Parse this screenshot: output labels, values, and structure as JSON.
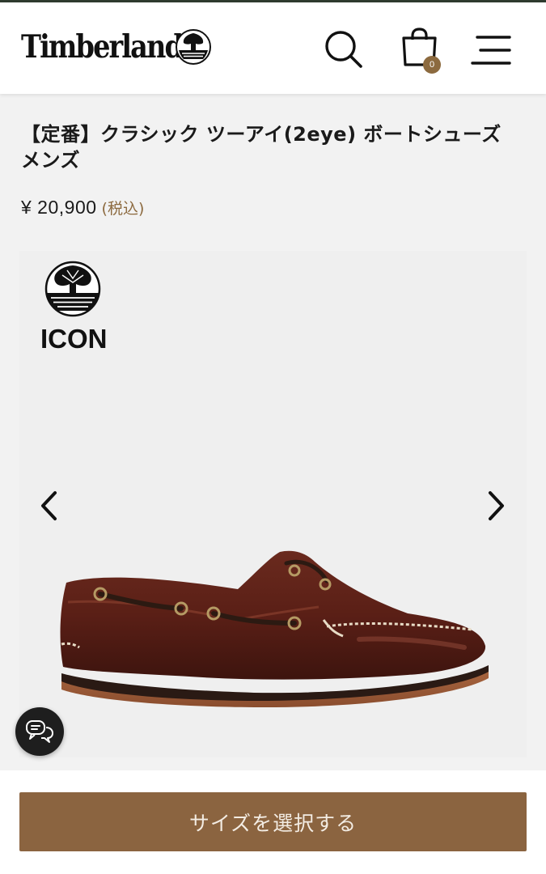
{
  "header": {
    "brand": "Timberland",
    "cart_count": "0",
    "search_icon": "search-icon",
    "cart_icon": "shopping-bag-icon",
    "menu_icon": "hamburger-menu-icon"
  },
  "product": {
    "title": "【定番】クラシック ツーアイ(2eye) ボートシューズ メンズ",
    "price": "¥ 20,900",
    "tax_note": "(税込)"
  },
  "gallery": {
    "badge_label": "ICON",
    "prev_icon": "chevron-left-icon",
    "next_icon": "chevron-right-icon",
    "image": "brown-leather-boat-shoe"
  },
  "chat": {
    "icon": "chat-bubbles-icon"
  },
  "cta": {
    "select_size_label": "サイズを選択する"
  },
  "colors": {
    "accent": "#8b6440",
    "tax_text": "#8c6a3f",
    "background": "#f2f2f2",
    "header_bg": "#ffffff"
  }
}
